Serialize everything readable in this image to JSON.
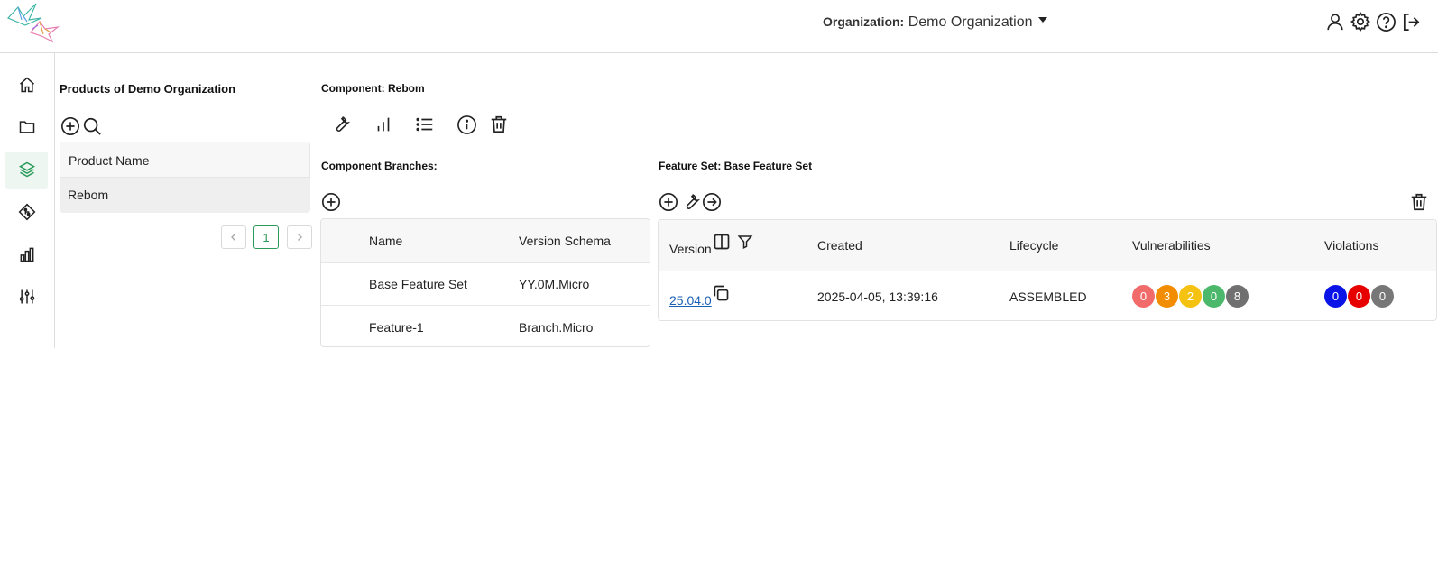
{
  "header": {
    "org_label": "Organization:",
    "org_name": "Demo Organization",
    "icons": [
      "user-icon",
      "gear-icon",
      "help-icon",
      "logout-icon"
    ]
  },
  "sidebar": {
    "items": [
      {
        "icon": "home-icon"
      },
      {
        "icon": "folder-icon"
      },
      {
        "icon": "layers-icon",
        "active": true
      },
      {
        "icon": "git-branch-icon"
      },
      {
        "icon": "bar-chart-icon"
      },
      {
        "icon": "sliders-icon"
      }
    ]
  },
  "products": {
    "title": "Products of Demo Organization",
    "column_header": "Product Name",
    "rows": [
      "Rebom"
    ],
    "pagination": {
      "current_page": "1"
    }
  },
  "component": {
    "title": "Component: Rebom",
    "toolbar_icons": [
      "wrench-icon",
      "bar-chart-icon",
      "list-icon",
      "info-icon",
      "trash-icon"
    ]
  },
  "branches": {
    "title": "Component Branches:",
    "columns": {
      "name": "Name",
      "schema": "Version Schema"
    },
    "rows": [
      {
        "name": "Base Feature Set",
        "schema": "YY.0M.Micro"
      },
      {
        "name": "Feature-1",
        "schema": "Branch.Micro"
      }
    ]
  },
  "feature_set": {
    "title": "Feature Set: Base Feature Set",
    "columns": {
      "version": "Version",
      "created": "Created",
      "lifecycle": "Lifecycle",
      "vulnerabilities": "Vulnerabilities",
      "violations": "Violations"
    },
    "rows": [
      {
        "version": "25.04.0",
        "created": "2025-04-05, 13:39:16",
        "lifecycle": "ASSEMBLED",
        "vulnerabilities": [
          "0",
          "3",
          "2",
          "0",
          "8"
        ],
        "violations": [
          "0",
          "0",
          "0"
        ]
      }
    ]
  },
  "colors": {
    "accent": "#2b9a5a",
    "link": "#1a5fb4",
    "vuln_critical": "#f26b6b",
    "vuln_high": "#f28c00",
    "vuln_medium": "#f5c211",
    "vuln_low": "#4cb86b",
    "vuln_unassigned": "#707070",
    "viol_license": "#0a14e6",
    "viol_security": "#e60000",
    "viol_operational": "#777777"
  }
}
